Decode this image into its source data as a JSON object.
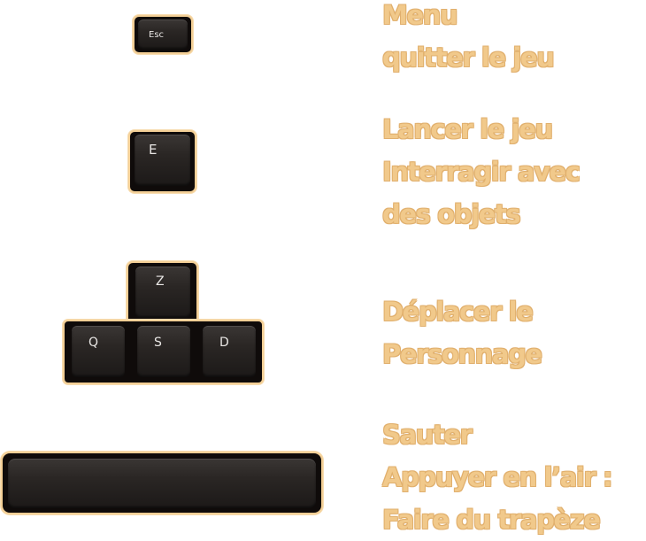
{
  "controls": [
    {
      "key": "esc",
      "key_labels": [
        "Esc"
      ],
      "description": [
        "Menu",
        "quitter le jeu"
      ]
    },
    {
      "key": "e",
      "key_labels": [
        "E"
      ],
      "description": [
        "Lancer le jeu",
        "Interragir avec",
        "des objets"
      ]
    },
    {
      "key": "zqsd",
      "key_labels": [
        "Z",
        "Q",
        "S",
        "D"
      ],
      "description": [
        "Déplacer le",
        "Personnage"
      ]
    },
    {
      "key": "space",
      "key_labels": [],
      "description": [
        "Sauter",
        "Appuyer en l’air :",
        "Faire du trapèze"
      ]
    }
  ],
  "colors": {
    "text": "#f1c98b",
    "key_outline": "#f3cf96",
    "key_body": "#0f0b0a"
  }
}
